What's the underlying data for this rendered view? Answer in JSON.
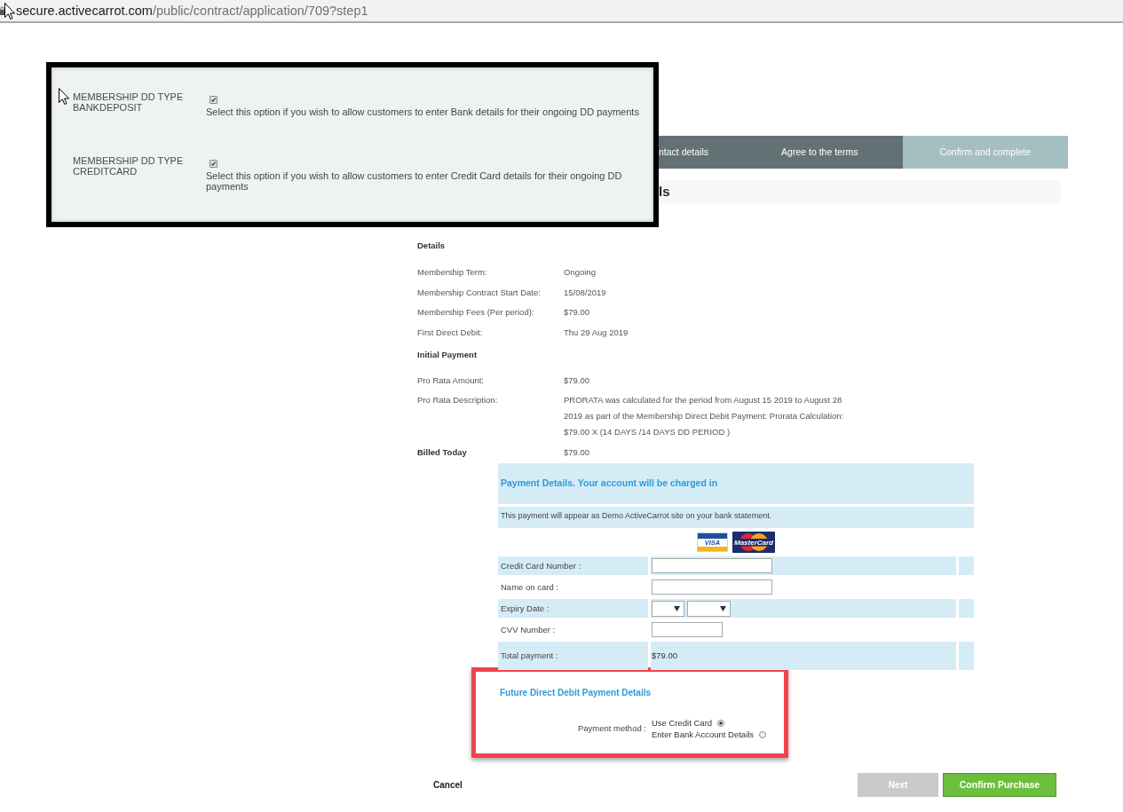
{
  "address_bar": {
    "host": "secure.activecarrot.com",
    "path": "/public/contract/application/709?step1"
  },
  "settings_inset": {
    "options": [
      {
        "label": "MEMBERSHIP DD TYPE BANKDEPOSIT",
        "checked": true,
        "description": "Select this option if you wish to allow customers to enter Bank details for their ongoing DD payments"
      },
      {
        "label": "MEMBERSHIP DD TYPE CREDITCARD",
        "checked": true,
        "description": "Select this option if you wish to allow customers to enter Credit Card details for their ongoing DD payments"
      }
    ]
  },
  "steps": [
    {
      "label": "ntact details",
      "selected": false
    },
    {
      "label": "Agree to the terms",
      "selected": false
    },
    {
      "label": "Confirm and complete",
      "selected": true
    }
  ],
  "page_heading": "ls",
  "details": {
    "title": "Details",
    "rows": [
      {
        "label": "Membership Term:",
        "value": "Ongoing"
      },
      {
        "label": "Membership Contract Start Date:",
        "value": "15/08/2019"
      },
      {
        "label": "Membership Fees (Per period):",
        "value": "$79.00"
      },
      {
        "label": "First Direct Debit:",
        "value": "Thu 29 Aug 2019"
      }
    ]
  },
  "initial_payment": {
    "title": "Initial Payment",
    "rows": [
      {
        "label": "Pro Rata Amount:",
        "value": "$79.00"
      },
      {
        "label": "Pro Rata Description:",
        "value": "PRORATA was calculated for the period from August 15 2019 to August 28 2019 as part of the Membership Direct Debit Payment: Prorata Calculation: $79.00 X (14 DAYS /14 DAYS DD PERIOD )"
      }
    ]
  },
  "billed_today": {
    "label": "Billed Today",
    "value": "$79.00"
  },
  "payment": {
    "title": "Payment Details. Your account will be charged in",
    "note": "This payment will appear as Demo ActiveCarrot site on your bank statement.",
    "card_logos": [
      {
        "kind": "visa",
        "text": "VISA"
      },
      {
        "kind": "mastercard",
        "text": "MasterCard"
      }
    ],
    "fields": [
      {
        "kind": "text",
        "label": "Credit Card Number :"
      },
      {
        "kind": "text",
        "label": "Name on card :"
      },
      {
        "kind": "expiry",
        "label": "Expiry Date :"
      },
      {
        "kind": "short",
        "label": "CVV Number :"
      },
      {
        "kind": "amount",
        "label": "Total payment :",
        "value": "$79.00"
      }
    ]
  },
  "future_dd": {
    "title": "Future Direct Debit Payment Details",
    "label": "Payment method :",
    "options": [
      {
        "label": "Use Credit Card",
        "selected": true
      },
      {
        "label": "Enter Bank Account Details",
        "selected": false
      }
    ]
  },
  "actions": {
    "cancel": "Cancel",
    "next": {
      "label": "Next",
      "disabled": true
    },
    "confirm": "Confirm Purchase"
  }
}
